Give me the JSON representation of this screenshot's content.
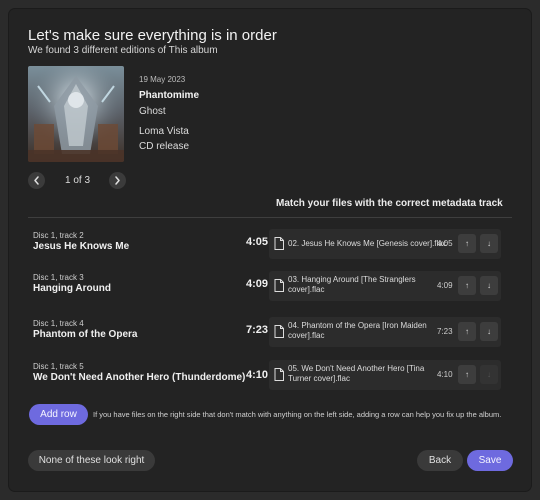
{
  "dialog": {
    "title": "Let's make sure everything is in order",
    "subtitle": "We found 3 different editions of This album"
  },
  "album": {
    "date": "19 May 2023",
    "release": "Phantomime",
    "artist": "Ghost",
    "label": "Loma Vista",
    "format": "CD release"
  },
  "pager": {
    "prev_icon": "chevron-left-icon",
    "next_icon": "chevron-right-icon",
    "text": "1 of 3"
  },
  "match_header": "Match your files with the correct metadata track",
  "tracks": [
    {
      "position": "Disc 1, track 2",
      "title": "Jesus He Knows Me",
      "length": "4:05",
      "file_name": "02. Jesus He Knows Me [Genesis cover].flac",
      "file_length": "4:05"
    },
    {
      "position": "Disc 1, track 3",
      "title": "Hanging Around",
      "length": "4:09",
      "file_name": "03. Hanging Around [The Stranglers cover].flac",
      "file_length": "4:09"
    },
    {
      "position": "Disc 1, track 4",
      "title": "Phantom of the Opera",
      "length": "7:23",
      "file_name": "04. Phantom of the Opera [Iron Maiden cover].flac",
      "file_length": "7:23"
    },
    {
      "position": "Disc 1, track 5",
      "title": "We Don't Need Another Hero (Thunderdome)",
      "length": "4:10",
      "file_name": "05. We Don't Need Another Hero [Tina Turner cover].flac",
      "file_length": "4:10"
    }
  ],
  "move_up_symbol": "↑",
  "move_down_symbol": "↓",
  "add_row": {
    "label": "Add row",
    "help": "If you have files on the right side that don't match with anything on the left side, adding a row can help you fix up the album."
  },
  "footer": {
    "none_label": "None of these look right",
    "back_label": "Back",
    "save_label": "Save"
  },
  "colors": {
    "background": "#232323",
    "accent": "#6e6adf",
    "button": "#3a3a3a"
  }
}
